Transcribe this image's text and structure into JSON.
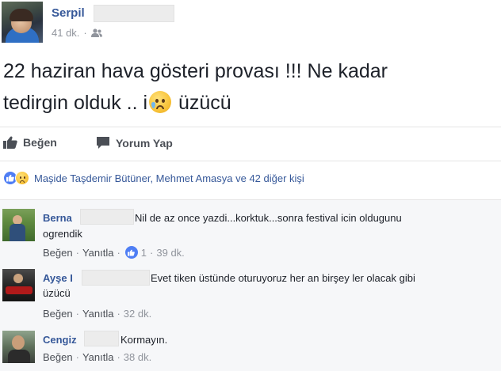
{
  "post": {
    "author": "Serpil",
    "time": "41 dk.",
    "sep": "·",
    "audience_icon": "friends-icon",
    "text_line1": "22 haziran hava gösteri provası !!! Ne kadar",
    "text_line2_a": "tedirgin olduk .. i",
    "text_line2_emoji": "sad-tear-emoji",
    "text_line2_b": " üzücü"
  },
  "actions": {
    "like_label": "Beğen",
    "comment_label": "Yorum Yap"
  },
  "reactions": {
    "summary": "Maşide Taşdemir Bütüner, Mehmet Amasya ve 42 diğer kişi"
  },
  "comments": [
    {
      "name": "Berna",
      "text_line1": "Nil de az once yazdi...korktuk...sonra festival icin oldugunu",
      "text_line2": "ogrendik",
      "like_label": "Beğen",
      "reply_label": "Yanıtla",
      "like_count": "1",
      "time": "39 dk."
    },
    {
      "name": "Ayşe I",
      "text_line1": "Evet tiken üstünde oturuyoruz her an birşey ler olacak gibi",
      "text_line2": "üzücü",
      "like_label": "Beğen",
      "reply_label": "Yanıtla",
      "time": "32 dk."
    },
    {
      "name": "Cengiz",
      "text_line1": "Kormayın.",
      "like_label": "Beğen",
      "reply_label": "Yanıtla",
      "time": "38 dk."
    }
  ],
  "colors": {
    "link_blue": "#365899",
    "meta_gray": "#90949c",
    "like_blue": "#4f7ef4",
    "comments_bg": "#f6f7f9"
  }
}
